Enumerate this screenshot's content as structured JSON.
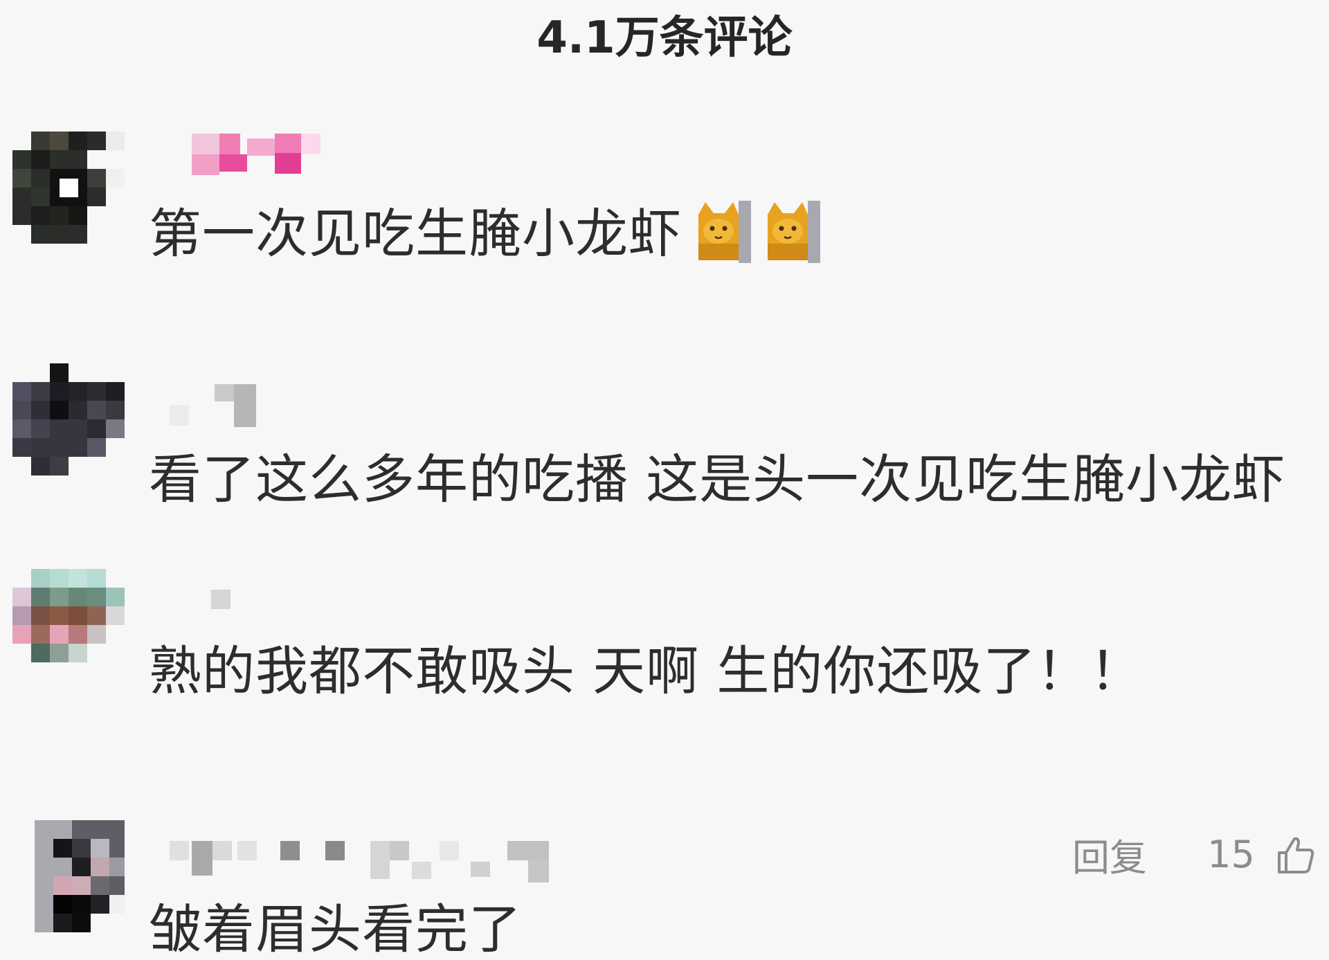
{
  "header": {
    "title": "4.1万条评论"
  },
  "comments": [
    {
      "text": "第一次见吃生腌小龙虾",
      "emojis": [
        "cat-face-emoji",
        "cat-face-emoji"
      ]
    },
    {
      "text": "看了这么多年的吃播 这是头一次见吃生腌小龙虾"
    },
    {
      "text": "熟的我都不敢吸头  天啊 生的你还吸了！！"
    },
    {
      "text": "皱着眉头看完了",
      "reply_label": "回复",
      "like_count": "15",
      "like_icon": "thumbs-up-icon"
    }
  ],
  "colors": {
    "background": "#f7f7f7",
    "text": "#2d2d2d",
    "secondary": "#8c8c8c",
    "emoji": "#e7a21f"
  }
}
